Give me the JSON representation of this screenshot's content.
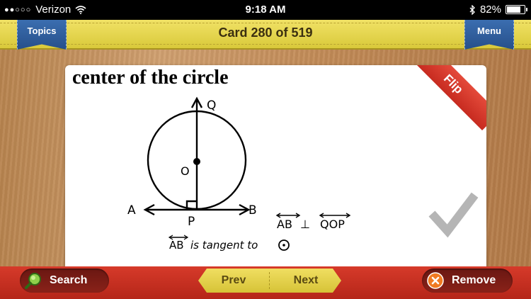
{
  "status_bar": {
    "carrier": "Verizon",
    "signal_dots": "●●○○○",
    "time": "9:18 AM",
    "battery": "82%",
    "battery_level": 0.82
  },
  "header": {
    "topics_label": "Topics",
    "title": "Card 280 of 519",
    "menu_label": "Menu"
  },
  "card": {
    "title": "center of the circle",
    "flip_label": "Flip",
    "diagram": {
      "point_q": "Q",
      "point_o": "O",
      "point_a": "A",
      "point_b": "B",
      "point_p": "P",
      "relation_left": "AB",
      "relation_symbol": "⊥",
      "relation_right": "QOP",
      "tangent_subject": "AB",
      "tangent_text": "is tangent to"
    }
  },
  "footer": {
    "search_label": "Search",
    "prev_label": "Prev",
    "next_label": "Next",
    "remove_label": "Remove"
  },
  "colors": {
    "header_yellow": "#e6d54e",
    "ribbon_blue": "#2f5c9c",
    "flip_red": "#d93a2c",
    "footer_red": "#c52f22",
    "check_gray": "#b5b5b5"
  }
}
